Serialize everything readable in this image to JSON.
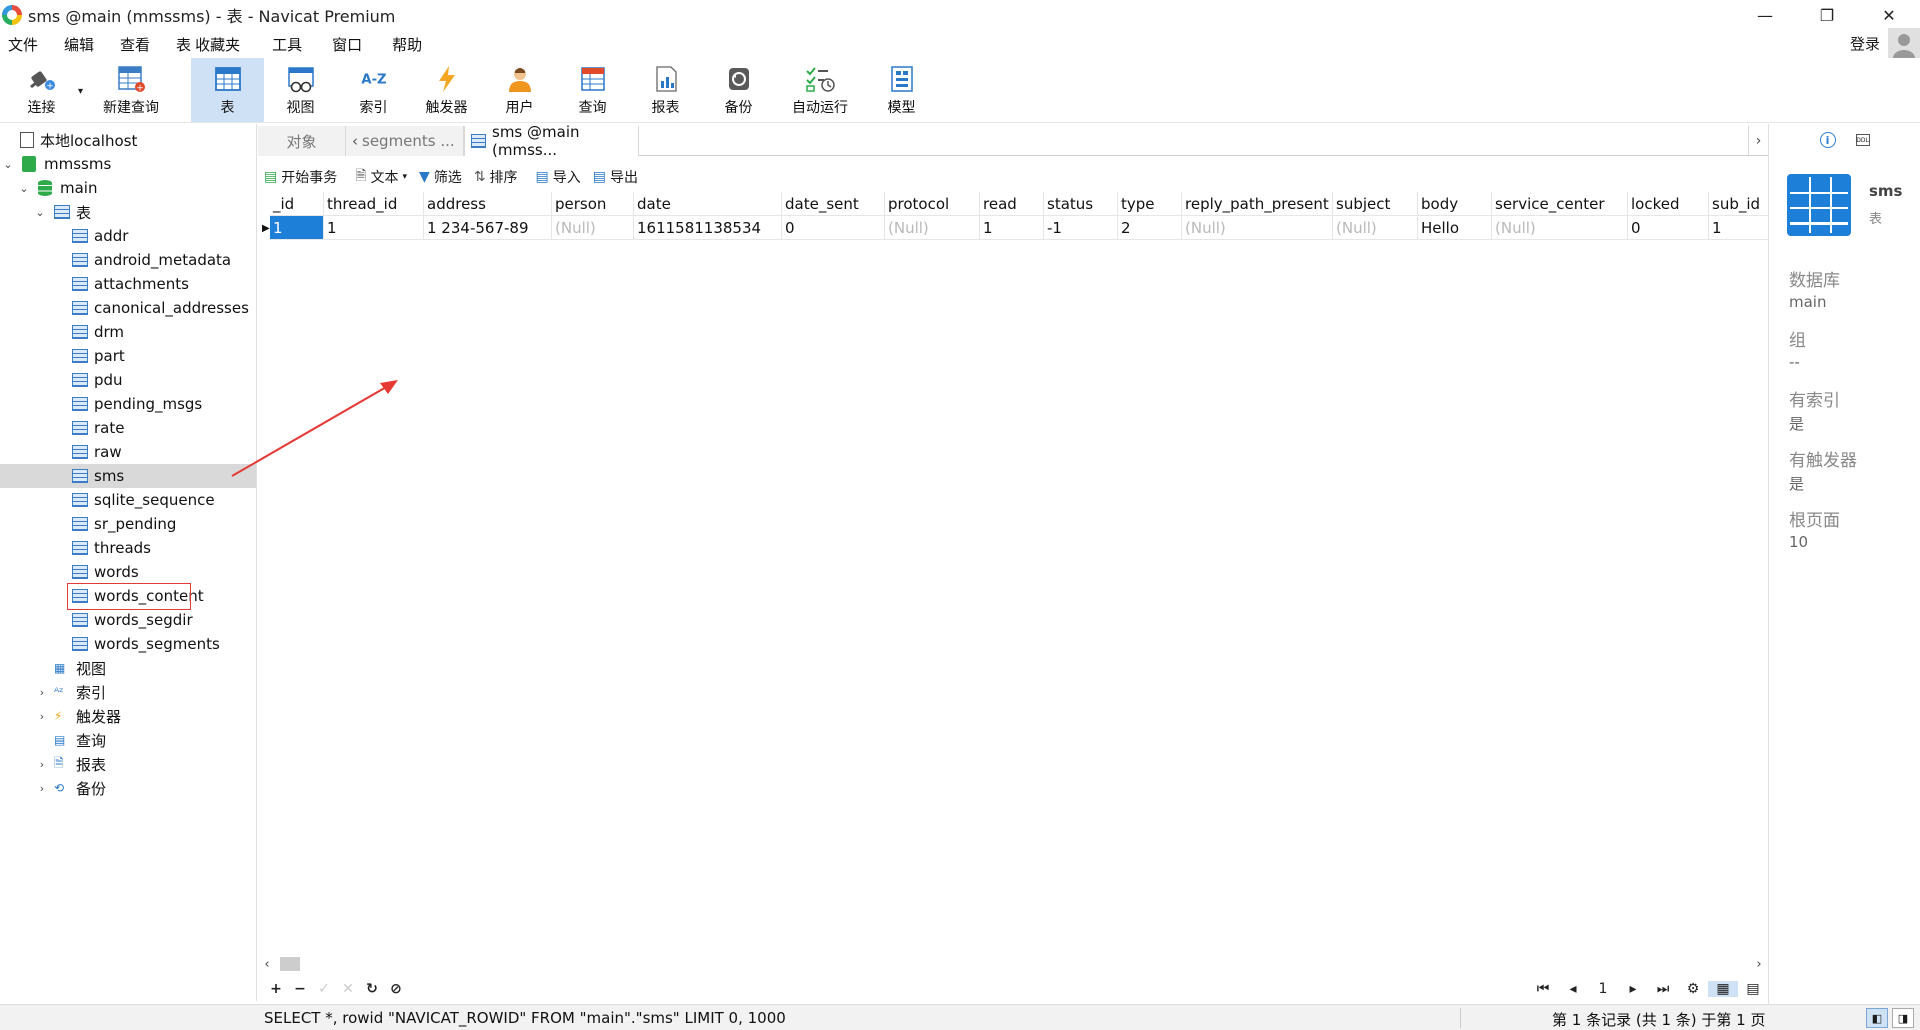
{
  "window": {
    "title": "sms @main (mmssms) - 表 - Navicat Premium",
    "minimize": "—",
    "maximize": "❐",
    "close": "✕"
  },
  "menu": [
    "文件",
    "编辑",
    "查看",
    "表",
    "收藏夹",
    "工具",
    "窗口",
    "帮助"
  ],
  "account": {
    "login_label": "登录"
  },
  "toolbar": [
    {
      "label": "连接",
      "icon": "plug-icon"
    },
    {
      "label": "新建查询",
      "icon": "new-query-icon"
    },
    {
      "label": "表",
      "icon": "table-icon"
    },
    {
      "label": "视图",
      "icon": "view-icon"
    },
    {
      "label": "索引",
      "icon": "index-icon"
    },
    {
      "label": "触发器",
      "icon": "trigger-icon"
    },
    {
      "label": "用户",
      "icon": "user-icon"
    },
    {
      "label": "查询",
      "icon": "query-icon"
    },
    {
      "label": "报表",
      "icon": "report-icon"
    },
    {
      "label": "备份",
      "icon": "backup-icon"
    },
    {
      "label": "自动运行",
      "icon": "automation-icon"
    },
    {
      "label": "模型",
      "icon": "model-icon"
    }
  ],
  "tree": {
    "connection": "本地localhost",
    "database": "mmssms",
    "schema": "main",
    "tables_group": "表",
    "tables": [
      "addr",
      "android_metadata",
      "attachments",
      "canonical_addresses",
      "drm",
      "part",
      "pdu",
      "pending_msgs",
      "rate",
      "raw",
      "sms",
      "sqlite_sequence",
      "sr_pending",
      "threads",
      "words",
      "words_content",
      "words_segdir",
      "words_segments"
    ],
    "selected_table": "sms",
    "other_groups": [
      "视图",
      "索引",
      "触发器",
      "查询",
      "报表",
      "备份"
    ]
  },
  "tabs": {
    "objects": "对象",
    "segments": "segments ...",
    "active": "sms @main (mmss..."
  },
  "editor_toolbar": {
    "begin_tx": "开始事务",
    "text": "文本",
    "filter": "筛选",
    "sort": "排序",
    "import": "导入",
    "export": "导出"
  },
  "grid": {
    "columns": [
      "_id",
      "thread_id",
      "address",
      "person",
      "date",
      "date_sent",
      "protocol",
      "read",
      "status",
      "type",
      "reply_path_present",
      "subject",
      "body",
      "service_center",
      "locked",
      "sub_id"
    ],
    "rows": [
      [
        "1",
        "1",
        "1 234-567-89",
        "(Null)",
        "1611581138534",
        "0",
        "(Null)",
        "1",
        "-1",
        "2",
        "(Null)",
        "(Null)",
        "Hello",
        "(Null)",
        "0",
        "1"
      ]
    ]
  },
  "record_nav": {
    "page": "1"
  },
  "status": {
    "sql": "SELECT *, rowid \"NAVICAT_ROWID\" FROM \"main\".\"sms\" LIMIT 0, 1000",
    "records": "第 1 条记录 (共 1 条) 于第 1 页"
  },
  "info": {
    "name": "sms",
    "type": "表",
    "fields": [
      {
        "key": "数据库",
        "value": "main"
      },
      {
        "key": "组",
        "value": "--"
      },
      {
        "key": "有索引",
        "value": "是"
      },
      {
        "key": "有触发器",
        "value": "是"
      },
      {
        "key": "根页面",
        "value": "10"
      }
    ]
  },
  "colors": {
    "accent": "#1e7fd8",
    "annotation": "#e53935",
    "selected_tool": "#cfe2f5"
  }
}
